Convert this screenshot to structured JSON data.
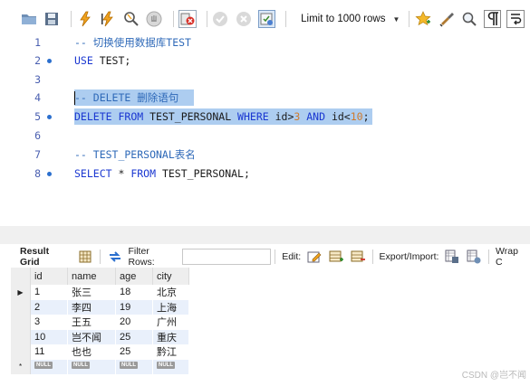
{
  "toolbar": {
    "limit_label": "Limit to 1000 rows",
    "buttons": [
      {
        "name": "folder-icon"
      },
      {
        "name": "save-icon"
      },
      {
        "name": "execute-lightning-icon"
      },
      {
        "name": "execute-cursor-lightning-icon"
      },
      {
        "name": "explain-magnifier-icon"
      },
      {
        "name": "stop-icon"
      },
      {
        "name": "toggle-error-icon"
      },
      {
        "name": "commit-icon"
      },
      {
        "name": "rollback-icon"
      },
      {
        "name": "autocommit-icon"
      },
      {
        "name": "bookmark-star-icon"
      },
      {
        "name": "beautify-brush-icon"
      },
      {
        "name": "find-icon"
      },
      {
        "name": "invisible-chars-icon"
      },
      {
        "name": "wrap-icon"
      }
    ]
  },
  "editor": {
    "lines": [
      {
        "num": "1",
        "text": "-- 切换使用数据库TEST"
      },
      {
        "num": "2",
        "kw1": "USE",
        "rest": " TEST;"
      },
      {
        "num": "3"
      },
      {
        "num": "4",
        "text": "-- DELETE 删除语句"
      },
      {
        "num": "5",
        "p1": "DELETE",
        "p2": " ",
        "p3": "FROM",
        "p4": " TEST_PERSONAL ",
        "p5": "WHERE",
        "p6": " id>",
        "p7": "3",
        "p8": " ",
        "p9": "AND",
        "p10": " id<",
        "p11": "10",
        "p12": ";"
      },
      {
        "num": "6"
      },
      {
        "num": "7",
        "text": "-- TEST_PERSONAL表名"
      },
      {
        "num": "8",
        "p1": "SELECT",
        "p2": " * ",
        "p3": "FROM",
        "p4": " TEST_PERSONAL;"
      }
    ]
  },
  "result_toolbar": {
    "tab": "Result Grid",
    "filter_label": "Filter Rows:",
    "filter_value": "",
    "edit_label": "Edit:",
    "export_label": "Export/Import:",
    "wrap_label": "Wrap C"
  },
  "grid": {
    "columns": [
      "id",
      "name",
      "age",
      "city"
    ],
    "rows": [
      [
        "1",
        "张三",
        "18",
        "北京"
      ],
      [
        "2",
        "李四",
        "19",
        "上海"
      ],
      [
        "3",
        "王五",
        "20",
        "广州"
      ],
      [
        "10",
        "岂不闻",
        "25",
        "重庆"
      ],
      [
        "11",
        "也也",
        "25",
        "黔江"
      ]
    ],
    "null_label": "NULL",
    "new_row_marker": "*",
    "current_row_marker": "▶"
  },
  "watermark": "CSDN @岂不闻"
}
